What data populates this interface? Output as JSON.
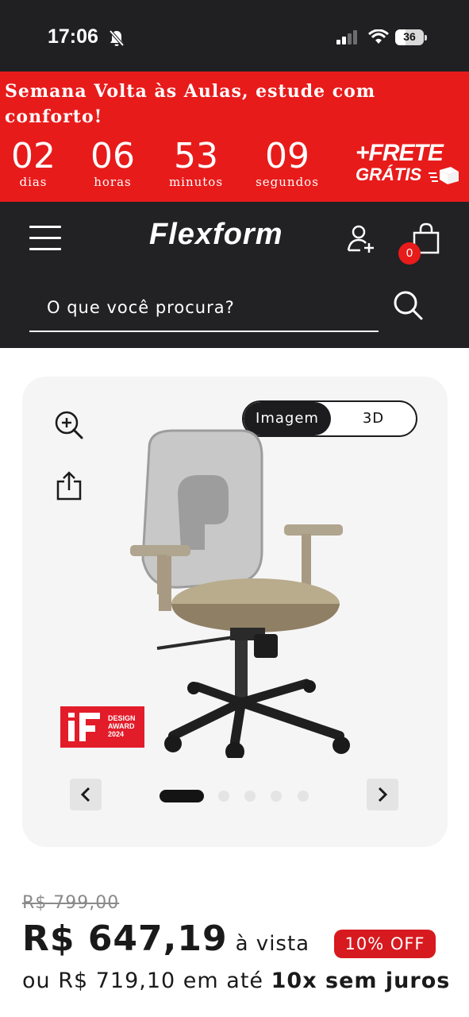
{
  "status_bar": {
    "time": "17:06",
    "battery": "36"
  },
  "promo": {
    "headline": "Semana Volta às Aulas, estude com conforto!",
    "countdown": [
      {
        "value": "02",
        "unit": "dias"
      },
      {
        "value": "06",
        "unit": "horas"
      },
      {
        "value": "53",
        "unit": "minutos"
      },
      {
        "value": "09",
        "unit": "segundos"
      }
    ],
    "shipping_line1": "+FRETE",
    "shipping_line2": "GRÁTIS",
    "background_color": "#e81b1b"
  },
  "header": {
    "logo": "Flexform",
    "cart_count": "0",
    "search_placeholder": "O que você procura?"
  },
  "gallery": {
    "view_options": [
      "Imagem",
      "3D"
    ],
    "selected_view": "Imagem",
    "award_lines": [
      "DESIGN",
      "AWARD",
      "2024"
    ],
    "slide_count": 5,
    "active_slide": 1
  },
  "price": {
    "old": "R$ 799,00",
    "current": "R$ 647,19",
    "current_suffix": "à vista",
    "discount": "10% OFF",
    "installments_prefix": "ou R$ 719,10 em até",
    "installments_bold": "10x sem juros"
  }
}
